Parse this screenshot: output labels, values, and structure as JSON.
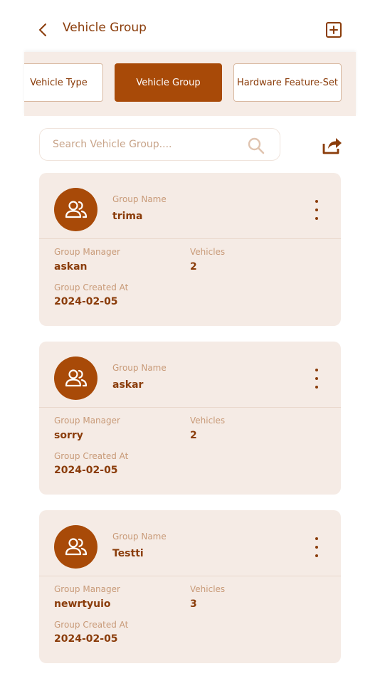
{
  "header": {
    "title": "Vehicle Group"
  },
  "tabs": [
    {
      "label": "Vehicle Type",
      "active": false
    },
    {
      "label": "Vehicle Group",
      "active": true
    },
    {
      "label": "Hardware Feature-Set",
      "active": false
    }
  ],
  "search": {
    "placeholder": "Search Vehicle Group...."
  },
  "labels": {
    "group_name": "Group Name",
    "group_manager": "Group Manager",
    "vehicles": "Vehicles",
    "group_created_at": "Group Created At"
  },
  "groups": [
    {
      "name": "trima",
      "manager": "askan",
      "vehicles": "2",
      "created_at": "2024-02-05"
    },
    {
      "name": "askar",
      "manager": "sorry",
      "vehicles": "2",
      "created_at": "2024-02-05"
    },
    {
      "name": "Testti",
      "manager": "newrtyuio",
      "vehicles": "3",
      "created_at": "2024-02-05"
    }
  ],
  "icons": {
    "back": "chevron-left-icon",
    "add": "plus-square-icon",
    "search": "search-icon",
    "share": "share-icon",
    "avatar": "users-icon",
    "menu": "more-vertical-icon"
  },
  "colors": {
    "accent": "#a84a08",
    "text": "#8a3c0a",
    "card_bg": "#f5ebe5",
    "label": "#c89a78"
  }
}
